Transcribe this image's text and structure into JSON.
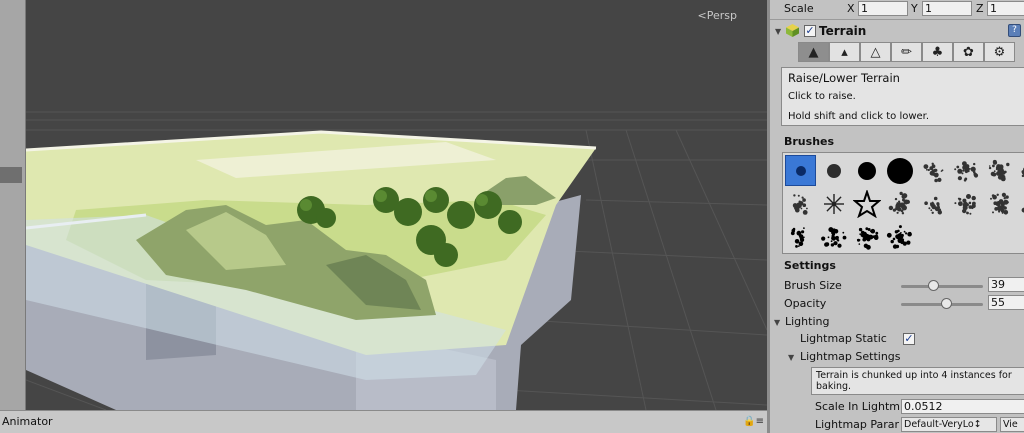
{
  "scene": {
    "view_label": "Persp",
    "view_icon": "perspective-arrow-icon"
  },
  "bottom_bar": {
    "label": "Animator",
    "lock_icon": "lock-icon",
    "menu_icon": "panel-menu-icon"
  },
  "transform": {
    "scale_label": "Scale",
    "x_label": "X",
    "x_value": "1",
    "y_label": "Y",
    "y_value": "1",
    "z_label": "Z",
    "z_value": "1"
  },
  "terrain": {
    "component_name": "Terrain",
    "enabled": true,
    "component_icon": "terrain-cube-icon",
    "help_icon": "help-book-icon",
    "tools": [
      {
        "name": "raise-lower-icon",
        "selected": true
      },
      {
        "name": "paint-height-icon",
        "selected": false
      },
      {
        "name": "smooth-height-icon",
        "selected": false
      },
      {
        "name": "paint-texture-icon",
        "selected": false
      },
      {
        "name": "place-trees-icon",
        "selected": false
      },
      {
        "name": "paint-details-icon",
        "selected": false
      },
      {
        "name": "terrain-settings-gear-icon",
        "selected": false
      }
    ],
    "tool_title": "Raise/Lower Terrain",
    "tool_help_1": "Click to raise.",
    "tool_help_2": "Hold shift and click to lower."
  },
  "brushes": {
    "header": "Brushes",
    "selected_index": 0,
    "count": 20
  },
  "settings": {
    "header": "Settings",
    "brush_size_label": "Brush Size",
    "brush_size_value": "39",
    "brush_size_fraction": 0.39,
    "opacity_label": "Opacity",
    "opacity_value": "55",
    "opacity_fraction": 0.55
  },
  "lighting": {
    "header": "Lighting",
    "lightmap_static_label": "Lightmap Static",
    "lightmap_static_checked": true,
    "lightmap_settings_label": "Lightmap Settings",
    "info_text_1": "Terrain is chunked up into 4 instances for",
    "info_text_2": "baking.",
    "scale_label": "Scale In Lightm",
    "scale_value": "0.0512",
    "params_label": "Lightmap Parar",
    "params_value": "Default-VeryLo↕",
    "view_button": "Vie"
  },
  "colors": {
    "scene_bg": "#454545",
    "panel_bg": "#c2c2c2",
    "selection_blue": "#3a78d6"
  }
}
